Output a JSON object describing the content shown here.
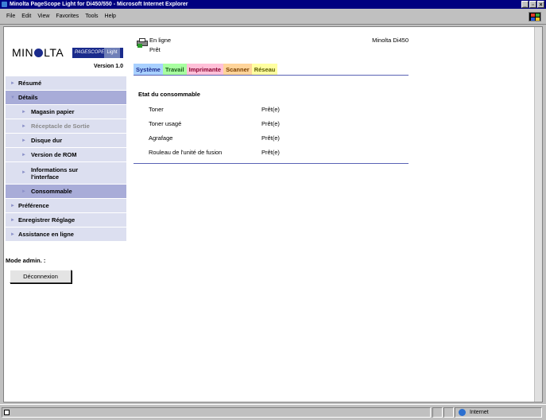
{
  "window": {
    "title": "Minolta PageScope Light for Di450/550 - Microsoft Internet Explorer",
    "controls": [
      "_",
      "▫",
      "×"
    ]
  },
  "menubar": {
    "items": [
      "File",
      "Edit",
      "View",
      "Favorites",
      "Tools",
      "Help"
    ]
  },
  "sidebar": {
    "logo_text": "MIN",
    "logo_text_after": "LTA",
    "badge_pagescope": "PAGESCOPE",
    "badge_light": "Light",
    "version": "Version 1.0",
    "items": [
      {
        "label": "Résumé"
      },
      {
        "label": "Détails"
      },
      {
        "label": "Magasin papier"
      },
      {
        "label": "Réceptacle de Sortie"
      },
      {
        "label": "Disque dur"
      },
      {
        "label": "Version de ROM"
      },
      {
        "label": "Informations sur l'interface"
      },
      {
        "label": "Consommable"
      },
      {
        "label": "Préférence"
      },
      {
        "label": "Enregistrer Réglage"
      },
      {
        "label": "Assistance en ligne"
      }
    ],
    "admin_label": "Mode admin. :",
    "logout_label": "Déconnexion"
  },
  "main": {
    "status_online": "En ligne",
    "status_ready": "Prêt",
    "model": "Minolta Di450",
    "tabs": [
      {
        "label": "Système",
        "color": "#a8d0ff"
      },
      {
        "label": "Travail",
        "color": "#a8ffa0"
      },
      {
        "label": "Imprimante",
        "color": "#ffc0d8"
      },
      {
        "label": "Scanner",
        "color": "#ffd49a"
      },
      {
        "label": "Réseau",
        "color": "#ffffa0"
      }
    ],
    "section_title": "Etat du consommable",
    "rows": [
      {
        "name": "Toner",
        "value": "Prêt(e)"
      },
      {
        "name": "Toner usagé",
        "value": "Prêt(e)"
      },
      {
        "name": "Agrafage",
        "value": "Prêt(e)"
      },
      {
        "name": "Rouleau de l'unité de fusion",
        "value": "Prêt(e)"
      }
    ]
  },
  "statusbar": {
    "zone": "Internet"
  },
  "colors": {
    "titlebar": "#000080",
    "nav_bg": "#dcdff0",
    "nav_active": "#a8acd8",
    "rule": "#5a63b5"
  }
}
